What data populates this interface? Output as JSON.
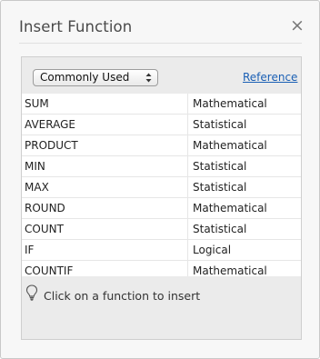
{
  "dialog": {
    "title": "Insert Function",
    "close_symbol": "×"
  },
  "toolbar": {
    "category_selected": "Commonly Used",
    "reference_label": "Reference"
  },
  "functions": [
    {
      "name": "SUM",
      "category": "Mathematical"
    },
    {
      "name": "AVERAGE",
      "category": "Statistical"
    },
    {
      "name": "PRODUCT",
      "category": "Mathematical"
    },
    {
      "name": "MIN",
      "category": "Statistical"
    },
    {
      "name": "MAX",
      "category": "Statistical"
    },
    {
      "name": "ROUND",
      "category": "Mathematical"
    },
    {
      "name": "COUNT",
      "category": "Statistical"
    },
    {
      "name": "IF",
      "category": "Logical"
    },
    {
      "name": "COUNTIF",
      "category": "Mathematical"
    }
  ],
  "hint": {
    "icon": "lightbulb-icon",
    "text": "Click on a function to insert"
  },
  "colors": {
    "link": "#1a5fb4",
    "panel_bg": "#ebebeb",
    "dialog_bg": "#f7f7f7"
  }
}
